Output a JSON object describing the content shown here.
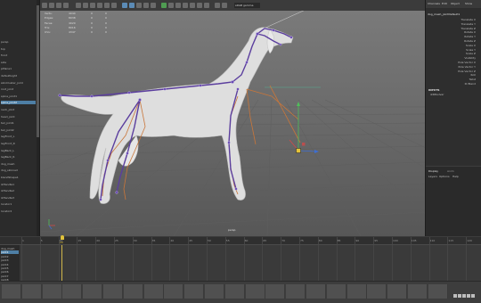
{
  "hud": {
    "rows": [
      {
        "label": "Verts:",
        "v1": "4044",
        "v2": "0",
        "v3": "0"
      },
      {
        "label": "Edges:",
        "v1": "8038",
        "v2": "0",
        "v3": "0"
      },
      {
        "label": "Faces:",
        "v1": "4020",
        "v2": "0",
        "v3": "0"
      },
      {
        "label": "Tris:",
        "v1": "8016",
        "v2": "0",
        "v3": "0"
      },
      {
        "label": "UVs:",
        "v1": "4347",
        "v2": "0",
        "v3": "0"
      }
    ],
    "camera_label": "persp",
    "toolbar_field": "sRGB gamma"
  },
  "outliner": {
    "items": [
      "persp",
      "top",
      "front",
      "side",
      "pPlane1",
      "defaultLight",
      "skinCluster_joint",
      "root_joint",
      "spine_joint1",
      "spine_joint2",
      "neck_joint",
      "head_joint",
      "tail_joint1",
      "tail_joint2",
      "legFront_L",
      "legFront_R",
      "legBack_L",
      "legBack_R",
      "dog_mesh",
      "dog_skinned",
      "blendShape1",
      "ikHandle1",
      "ikHandle2",
      "ikHandle3",
      "locator1",
      "locator2"
    ],
    "selected_index": 9
  },
  "right_panel": {
    "menu": [
      "Channels",
      "Edit",
      "Object",
      "Show"
    ],
    "title": "dog_mesh_jointDefault1",
    "channels": [
      "Translate X",
      "Translate Y",
      "Translate Z",
      "Rotate X",
      "Rotate Y",
      "Rotate Z",
      "Scale X",
      "Scale Y",
      "Scale Z",
      "Visibility",
      "Pole Vector X",
      "Pole Vector Y",
      "Pole Vector Z",
      "Roll",
      "Twist",
      "IK Blend"
    ],
    "inputs_header": "INPUTS",
    "inputs_item": "ikRPsolver",
    "layers_tabs": [
      "Display",
      "Anim"
    ],
    "layers_menu": [
      "Layers",
      "Options",
      "Help"
    ]
  },
  "timeline": {
    "ticks": [
      "1",
      "5",
      "10",
      "15",
      "20",
      "25",
      "30",
      "35",
      "40",
      "45",
      "50",
      "55",
      "60",
      "65",
      "70",
      "75",
      "80",
      "85",
      "90",
      "95",
      "100",
      "105",
      "110",
      "115",
      "120"
    ],
    "current_frame": "20"
  },
  "graph_editor": {
    "items": [
      "dog_mesh",
      "joint1",
      "joint2",
      "joint3",
      "joint4",
      "joint5",
      "joint6",
      "joint7",
      "joint8"
    ],
    "selected_index": 1
  },
  "colors": {
    "joint": "#5b3e9e",
    "bone": "#c9763a",
    "axis_x": "#d14a4a",
    "axis_y": "#4fbf5a",
    "axis_z": "#3e6fd1",
    "selection": "#4e7fa5"
  }
}
